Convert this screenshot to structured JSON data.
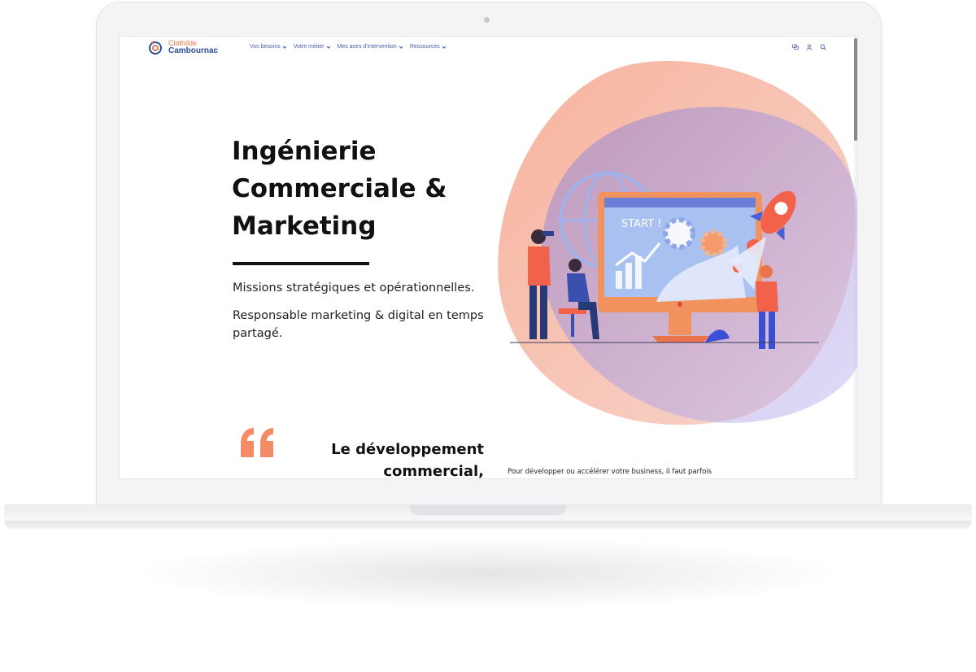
{
  "brand": {
    "name_line1": "Clothilde",
    "name_line2": "Cambournac",
    "accent_orange": "#ef7a53",
    "accent_blue": "#2a4a9a"
  },
  "nav": {
    "items": [
      {
        "label": "Vos besoins"
      },
      {
        "label": "Votre métier"
      },
      {
        "label": "Mes axes d'intervention"
      },
      {
        "label": "Ressources"
      }
    ]
  },
  "header_icons": [
    "chat-icon",
    "user-icon",
    "search-icon"
  ],
  "hero": {
    "title_lines": [
      "Ingénierie",
      "Commerciale &",
      "Marketing"
    ],
    "line1": "Missions stratégiques et opérationnelles.",
    "line2": "Responsable marketing & digital en temps partagé."
  },
  "illustration": {
    "start_label": "START !"
  },
  "quote_section": {
    "title": "Le développement commercial,",
    "body": "Pour développer ou accélérer votre business, il faut parfois"
  }
}
